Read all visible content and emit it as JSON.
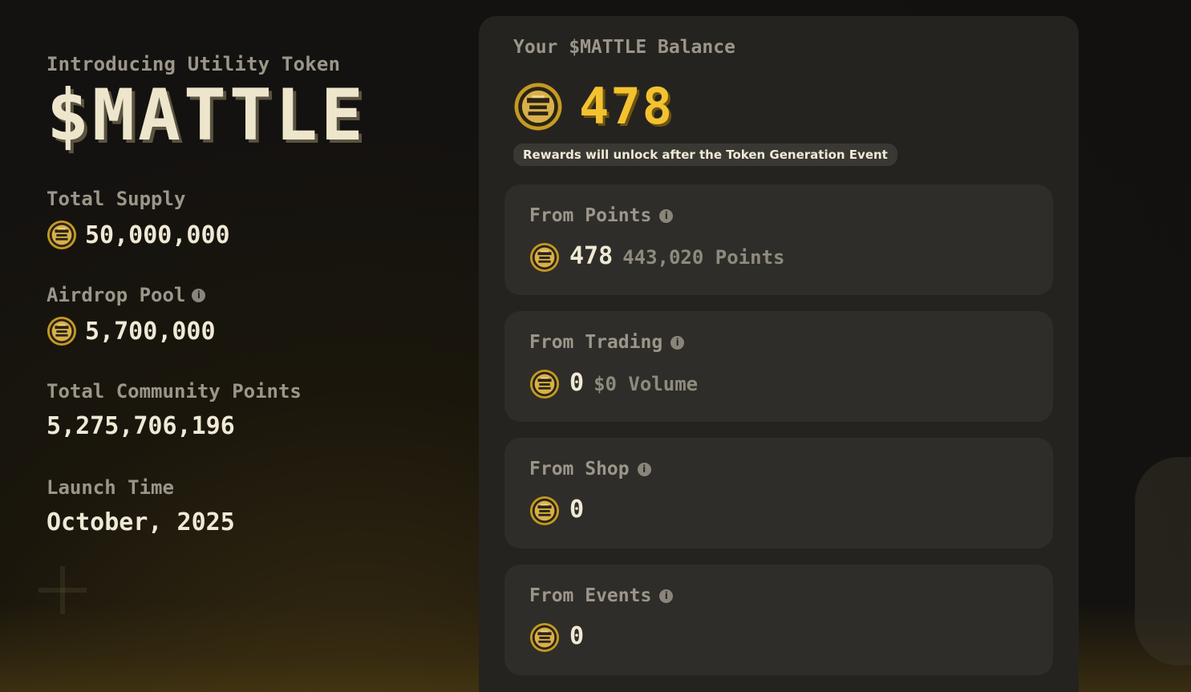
{
  "token": {
    "intro": "Introducing Utility Token",
    "name": "$MATTLE"
  },
  "stats": {
    "total_supply_label": "Total Supply",
    "total_supply_value": "50,000,000",
    "airdrop_pool_label": "Airdrop Pool",
    "airdrop_pool_value": "5,700,000",
    "community_points_label": "Total Community Points",
    "community_points_value": "5,275,706,196",
    "launch_time_label": "Launch Time",
    "launch_time_value": "October, 2025"
  },
  "balance": {
    "label": "Your $MATTLE Balance",
    "value": "478",
    "notice": "Rewards will unlock after the Token Generation Event"
  },
  "sources": [
    {
      "label": "From Points",
      "value": "478",
      "sub": "443,020 Points"
    },
    {
      "label": "From Trading",
      "value": "0",
      "sub": "$0 Volume"
    },
    {
      "label": "From Shop",
      "value": "0",
      "sub": ""
    },
    {
      "label": "From Events",
      "value": "0",
      "sub": ""
    }
  ],
  "icons": {
    "coin": "mattle-coin-icon",
    "info": "info-icon"
  },
  "colors": {
    "accent_gold": "#f2c230",
    "panel_bg": "#252320",
    "card_bg": "#2f2d29",
    "muted_text": "#9c968a"
  }
}
